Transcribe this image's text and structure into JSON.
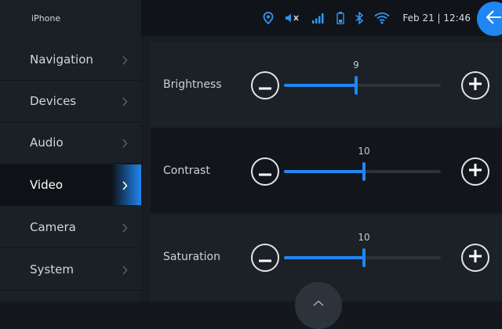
{
  "header": {
    "device_name": "iPhone",
    "datetime": "Feb 21 | 12:46",
    "status_icons": [
      "location-pin-icon",
      "speaker-muted-icon",
      "signal-bars-icon",
      "battery-icon",
      "bluetooth-icon",
      "wifi-icon"
    ],
    "back_icon": "arrow-left-icon"
  },
  "sidebar": {
    "items": [
      {
        "label": "Navigation"
      },
      {
        "label": "Devices"
      },
      {
        "label": "Audio"
      },
      {
        "label": "Video"
      },
      {
        "label": "Camera"
      },
      {
        "label": "System"
      }
    ],
    "active_index": 3
  },
  "settings": {
    "brightness": {
      "label": "Brightness",
      "value": "9",
      "level": 0.46
    },
    "contrast": {
      "label": "Contrast",
      "value": "10",
      "level": 0.51
    },
    "saturation": {
      "label": "Saturation",
      "value": "10",
      "level": 0.51
    }
  },
  "colors": {
    "accent": "#1f86f2",
    "background": "#14181d"
  }
}
